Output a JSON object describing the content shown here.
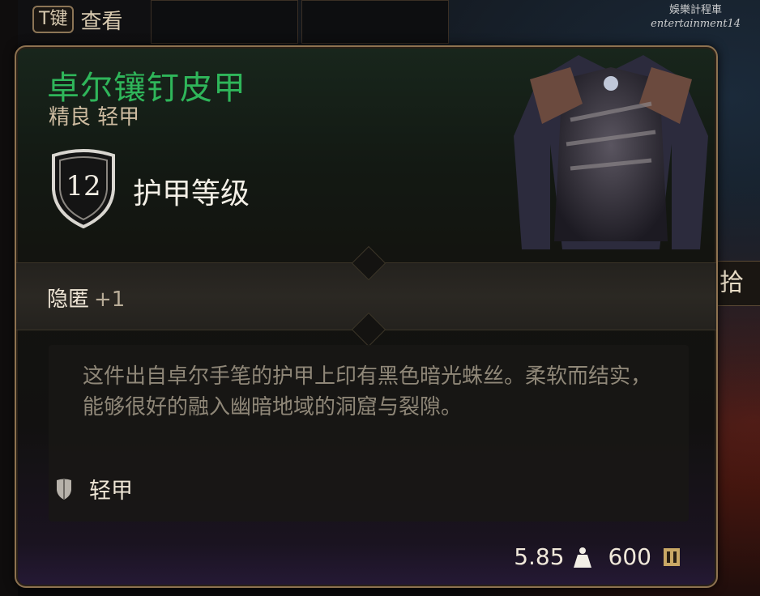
{
  "hint": {
    "key": "T键",
    "label": "查看"
  },
  "watermark": {
    "line1": "娛樂計程車",
    "line2": "entertainment14"
  },
  "side_button": {
    "label": "拾取"
  },
  "item": {
    "name": "卓尔镶钉皮甲",
    "subtitle": "精良 轻甲",
    "armor_class_value": "12",
    "armor_class_label": "护甲等级",
    "stat": {
      "label": "隐匿",
      "bonus": "+1"
    },
    "description": "这件出自卓尔手笔的护甲上印有黑色暗光蛛丝。柔软而结实，能够很好的融入幽暗地域的洞窟与裂隙。",
    "category": "轻甲",
    "weight": "5.85",
    "price": "600"
  },
  "colors": {
    "name_green": "#2fb65a",
    "border_gold": "#8d7250",
    "text_light": "#efe6d6",
    "desc_text": "#8f8778"
  },
  "icons": {
    "shield": "shield-icon",
    "armor_type": "light-armor-icon",
    "weight": "weight-icon",
    "gold": "gold-coin-icon"
  }
}
